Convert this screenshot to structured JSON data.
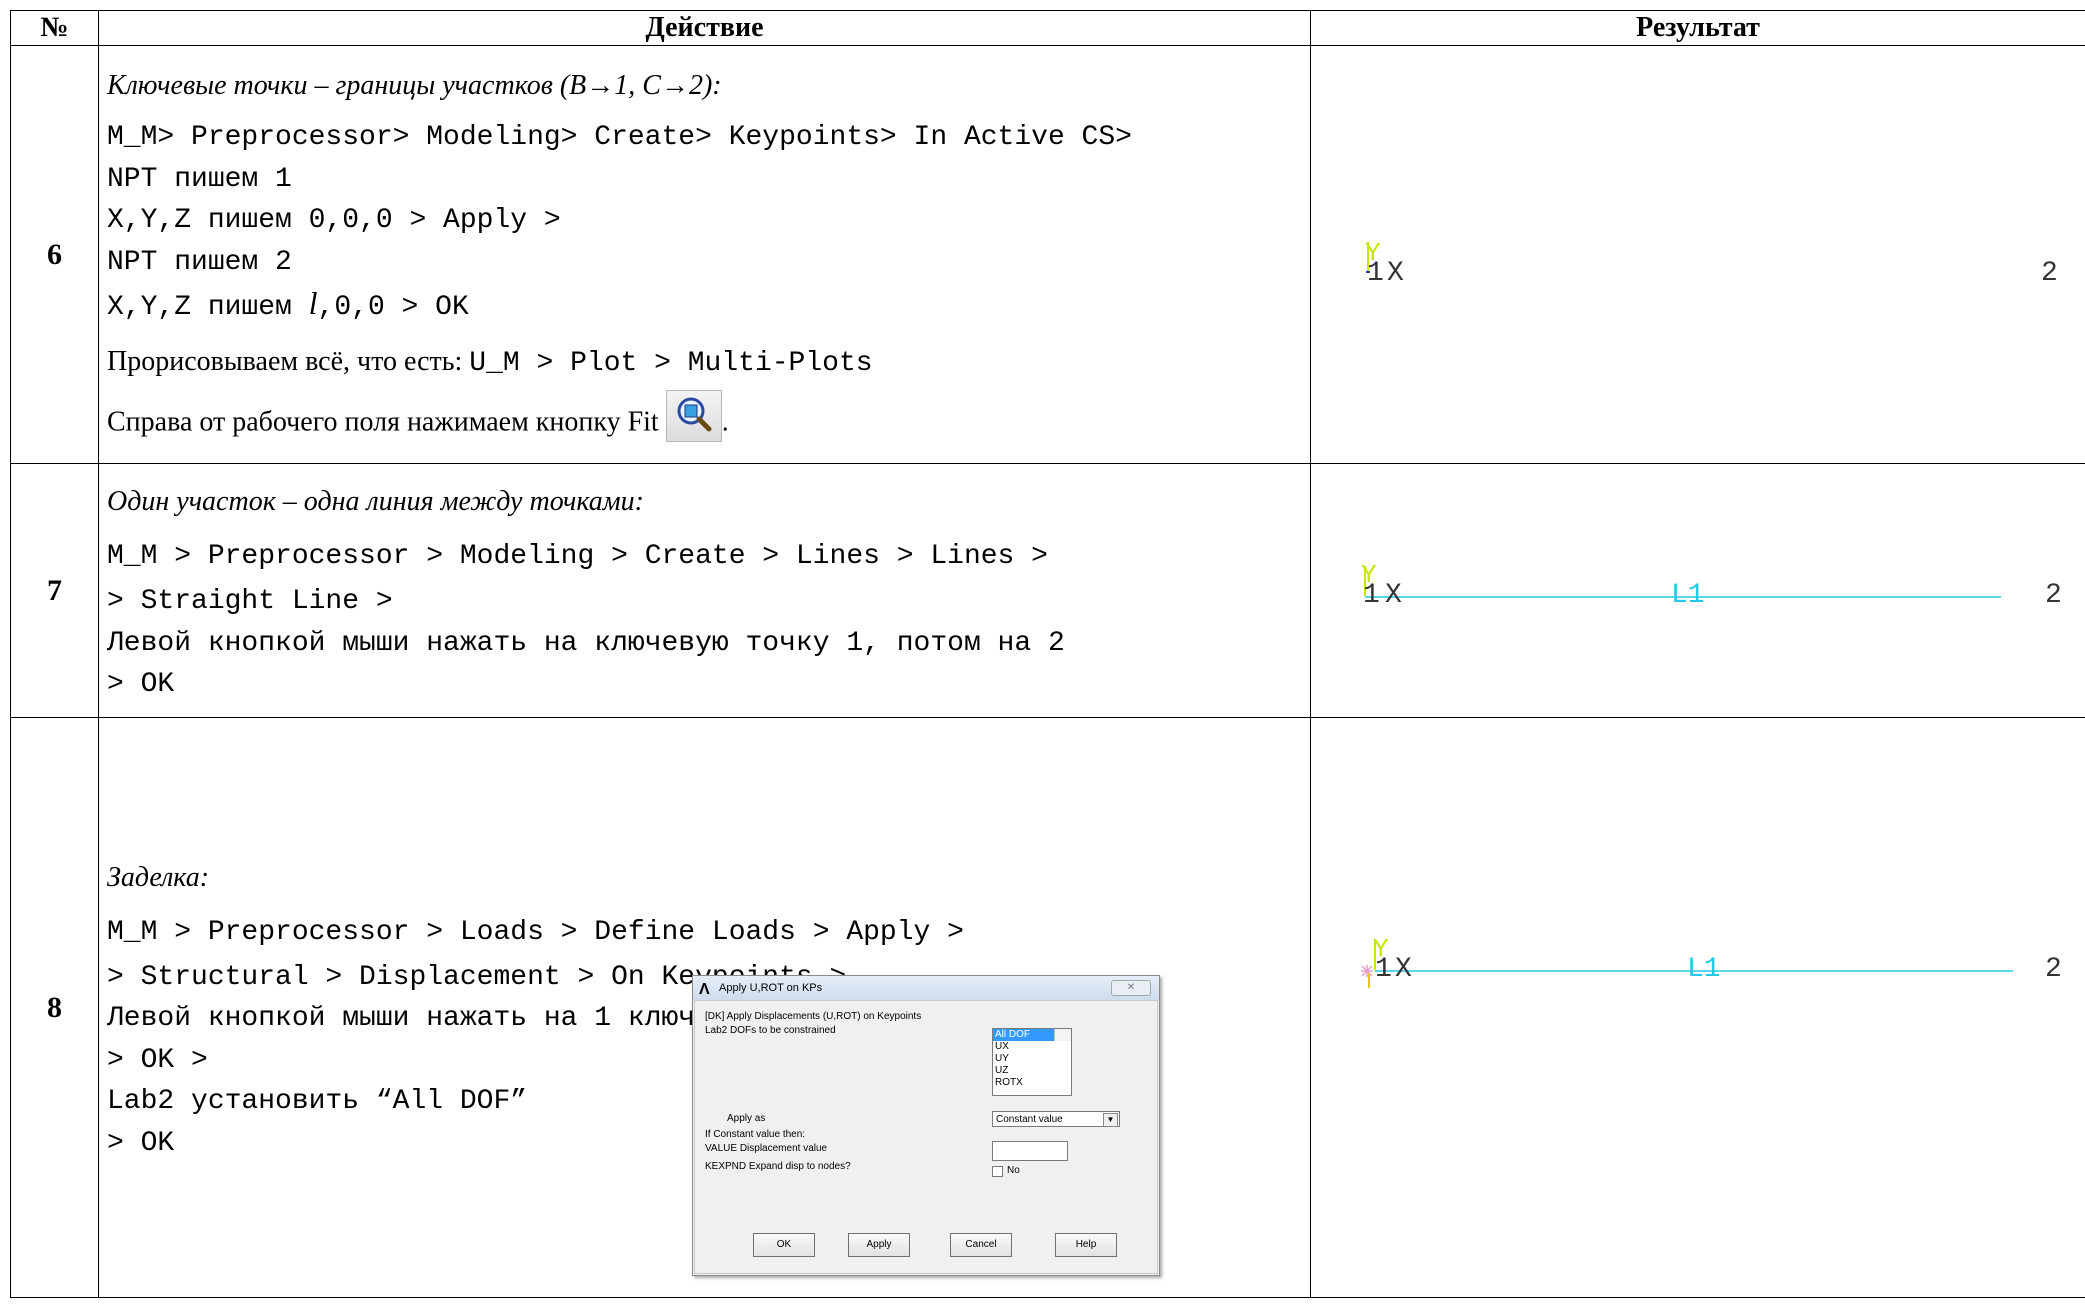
{
  "header": {
    "num": "№",
    "action": "Действие",
    "result": "Результат"
  },
  "rows": [
    {
      "num": "6",
      "title": "Ключевые точки – границы участков (B→1, C→2):",
      "code": [
        "M_M> Preprocessor> Modeling> Create> Keypoints> In Active CS>",
        "NPT пишем 1",
        "X,Y,Z пишем 0,0,0 > Apply >",
        "NPT пишем 2",
        "X,Y,Z пишем ",
        "l",
        ",0,0 > OK"
      ],
      "plot_text": "Прорисовываем всё, что есть: ",
      "plot_path": "U_M > Plot > Multi-Plots",
      "fit_text": "Справа от рабочего поля нажимаем кнопку Fit ",
      "fit_end": ".",
      "result": {
        "y": "Y",
        "x": "X",
        "kp1": "1",
        "kp2": "2"
      }
    },
    {
      "num": "7",
      "title": "Один участок –  одна линия между точками:",
      "code": [
        "M_M > Preprocessor > Modeling > Create > Lines > Lines >",
        "> Straight Line >",
        "Левой кнопкой мыши нажать на ключевую точку 1, потом на 2",
        "> OK"
      ],
      "result": {
        "y": "Y",
        "x": "X",
        "kp1": "1",
        "line": "L1",
        "kp2": "2"
      }
    },
    {
      "num": "8",
      "title": "Заделка:",
      "code": [
        "M_M > Preprocessor > Loads > Define Loads > Apply >",
        "> Structural > Displacement > On Keypoints >",
        "Левой кнопкой мыши нажать на 1 ключевую точку",
        "> OK >",
        "Lab2 установить “All DOF”",
        "> OK"
      ],
      "result": {
        "y": "Y",
        "x": "X",
        "kp1": "1",
        "line": "L1",
        "kp2": "2"
      }
    }
  ],
  "dialog": {
    "title": "Apply U,ROT on KPs",
    "subtitle": "[DK]  Apply Displacements (U,ROT) on Keypoints",
    "lab2": "Lab2   DOFs to be constrained",
    "dof_options": [
      "All DOF",
      "UX",
      "UY",
      "UZ",
      "ROTX"
    ],
    "apply_as": "Apply as",
    "apply_as_value": "Constant value",
    "if_const": "If Constant value then:",
    "value_label": "VALUE  Displacement value",
    "value": "",
    "kexpnd": "KEXPND  Expand disp to nodes?",
    "no": "No",
    "buttons": {
      "ok": "OK",
      "apply": "Apply",
      "cancel": "Cancel",
      "help": "Help"
    }
  },
  "colors": {
    "axis_y": "#c8e600",
    "axis_x": "#1e3cb4",
    "line": "#22c8e6",
    "kp": "#333333"
  }
}
